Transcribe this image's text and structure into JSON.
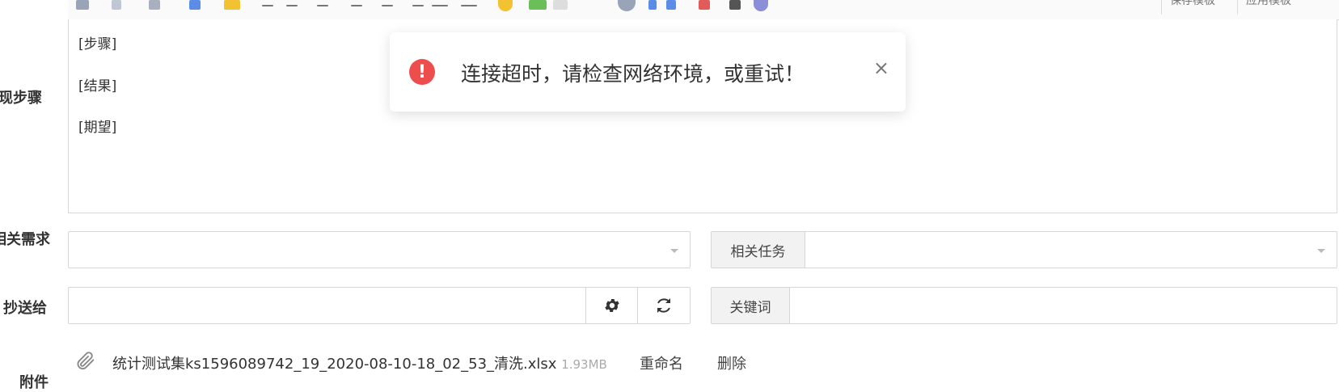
{
  "toolbar": {
    "save_template": "保存模板",
    "apply_template": "应用模板"
  },
  "steps": {
    "label": "重现步骤",
    "lines": [
      "[步骤]",
      "[结果]",
      "[期望]"
    ]
  },
  "related_story": {
    "label": "相关需求",
    "value": ""
  },
  "related_task": {
    "label": "相关任务",
    "value": ""
  },
  "mailto": {
    "label": "抄送给",
    "value": ""
  },
  "keywords": {
    "label": "关键词",
    "value": ""
  },
  "attachment": {
    "label": "附件",
    "file_name": "统计测试集ks1596089742_19_2020-08-10-18_02_53_清洗.xlsx",
    "file_size": "1.93MB",
    "rename": "重命名",
    "delete": "删除"
  },
  "toast": {
    "message": "连接超时，请检查网络环境，或重试！",
    "close": "×"
  },
  "icons": {
    "settings": "gear-icon",
    "refresh": "refresh-icon",
    "attachment": "paperclip-icon",
    "error": "exclamation-icon"
  },
  "colors": {
    "error": "#ee4d4d",
    "border": "#d6d6d6",
    "addon_bg": "#f2f2f2"
  }
}
